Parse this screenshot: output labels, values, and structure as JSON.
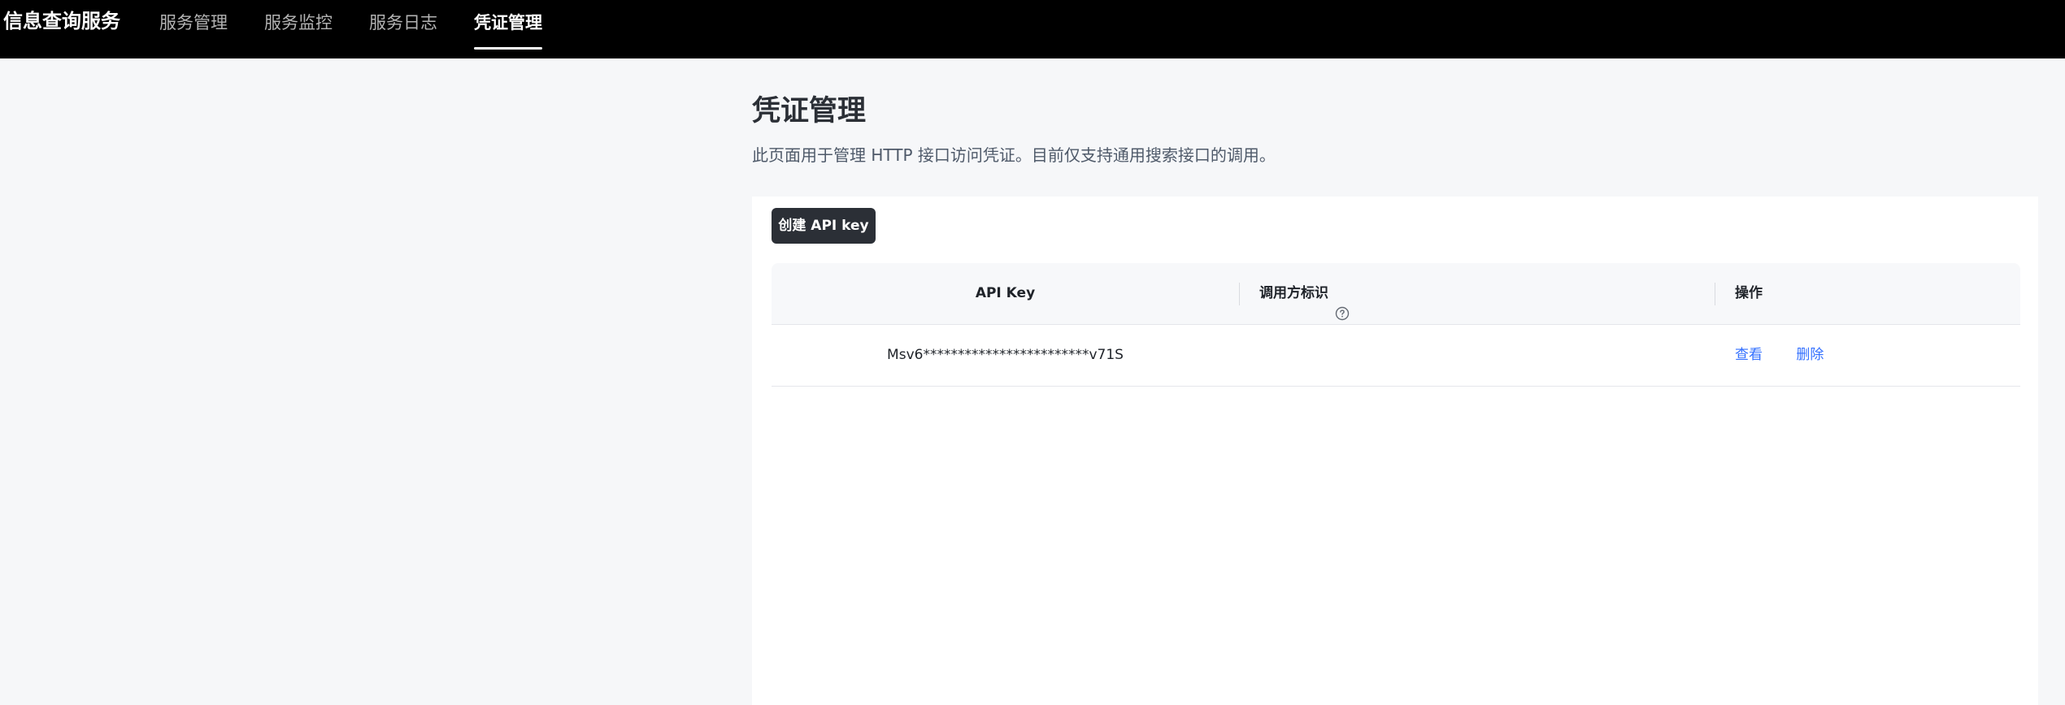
{
  "header": {
    "brand": "信息查询服务",
    "tabs": [
      {
        "label": "服务管理",
        "active": false
      },
      {
        "label": "服务监控",
        "active": false
      },
      {
        "label": "服务日志",
        "active": false
      },
      {
        "label": "凭证管理",
        "active": true
      }
    ]
  },
  "page": {
    "title": "凭证管理",
    "description": "此页面用于管理 HTTP 接口访问凭证。目前仅支持通用搜索接口的调用。"
  },
  "toolbar": {
    "create_label": "创建 API key"
  },
  "table": {
    "columns": [
      "API Key",
      "调用方标识",
      "操作"
    ],
    "help_icon": "question-circle-icon",
    "rows": [
      {
        "api_key": "Msv6************************v71S",
        "caller_id": "",
        "actions": [
          "查看",
          "删除"
        ]
      }
    ]
  },
  "colors": {
    "topbar_bg": "#000000",
    "primary_button_bg": "#2b2f36",
    "link": "#3370ff",
    "page_bg": "#f6f7f9"
  }
}
